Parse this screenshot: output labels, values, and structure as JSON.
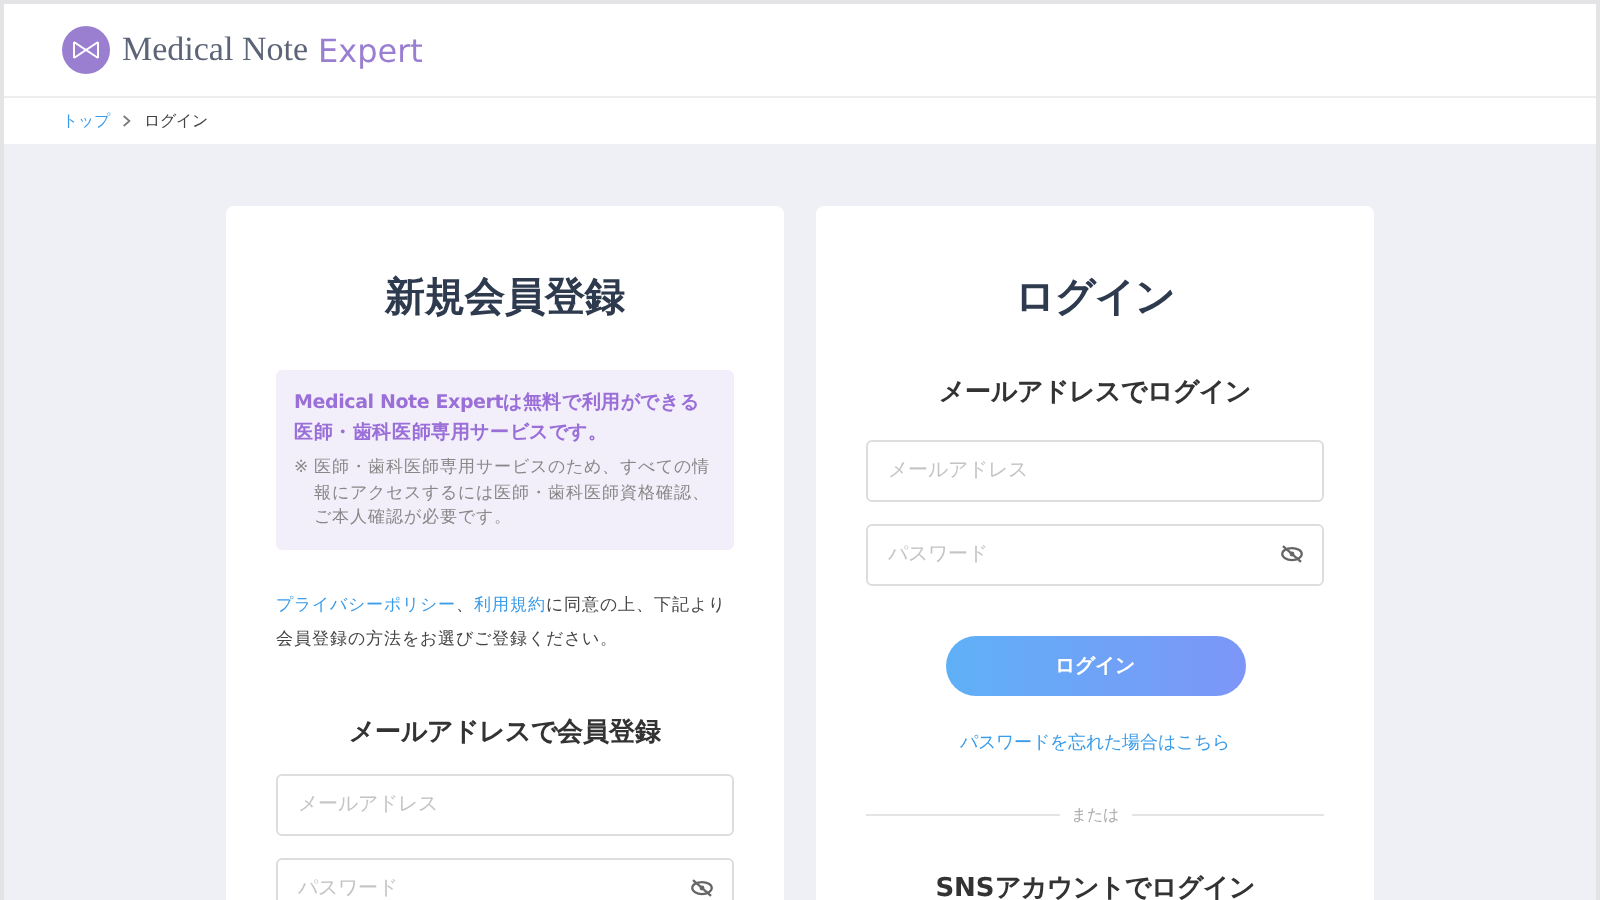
{
  "header": {
    "logo_main": "Medical Note",
    "logo_accent": "Expert"
  },
  "breadcrumb": [
    {
      "label": "トップ",
      "kind": "link"
    },
    {
      "label": "ログイン",
      "kind": "current"
    }
  ],
  "register": {
    "title": "新規会員登録",
    "notice": {
      "headline": "Medical Note Expertは無料で利用ができる医師・歯科医師専用サービスです。",
      "mark": "※",
      "note": "医師・歯科医師専用サービスのため、すべての情報にアクセスするには医師・歯科医師資格確認、ご本人確認が必要です。"
    },
    "consent": [
      {
        "text": "プライバシーポリシー",
        "kind": "link"
      },
      {
        "text": "、",
        "kind": "text"
      },
      {
        "text": "利用規約",
        "kind": "link"
      },
      {
        "text": "に同意の上、下記より会員登録の方法をお選びご登録ください。",
        "kind": "text"
      }
    ],
    "section_heading": "メールアドレスで会員登録",
    "fields": [
      {
        "placeholder": "メールアドレス",
        "kind": "email"
      },
      {
        "placeholder": "パスワード",
        "kind": "password"
      }
    ]
  },
  "login": {
    "title": "ログイン",
    "section_heading": "メールアドレスでログイン",
    "fields": [
      {
        "placeholder": "メールアドレス",
        "kind": "email"
      },
      {
        "placeholder": "パスワード",
        "kind": "password"
      }
    ],
    "button": "ログイン",
    "forgot_link": "パスワードを忘れた場合はこちら",
    "divider": "または",
    "sns_heading": "SNSアカウントでログイン"
  }
}
